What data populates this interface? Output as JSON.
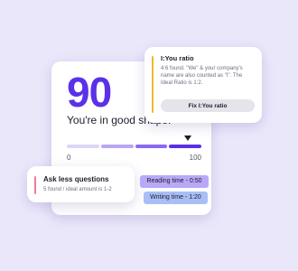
{
  "score_card": {
    "score": "90",
    "status": "You're in good shape!",
    "scale_min": "0",
    "scale_max": "100",
    "gauge_level_percent": 90
  },
  "ratio_card": {
    "title": "I:You ratio",
    "body": "4:6 found. \"We\" & your company's name are also counted as \"I\". The Ideal Ratio is 1:2.",
    "button_label": "Fix I:You ratio",
    "accent_color": "#f1b82d"
  },
  "questions_card": {
    "title": "Ask less questions",
    "subtitle": "5 found / ideal amount is 1-2",
    "accent_color": "#f07a9c"
  },
  "badges": {
    "reading_time": "Reading time - 0:50",
    "writing_time": "Writing time - 1:20"
  },
  "colors": {
    "background": "#ebe7fb",
    "accent": "#5a31e8",
    "reading_badge": "#b8a8f7",
    "writing_badge": "#a8bef6"
  }
}
